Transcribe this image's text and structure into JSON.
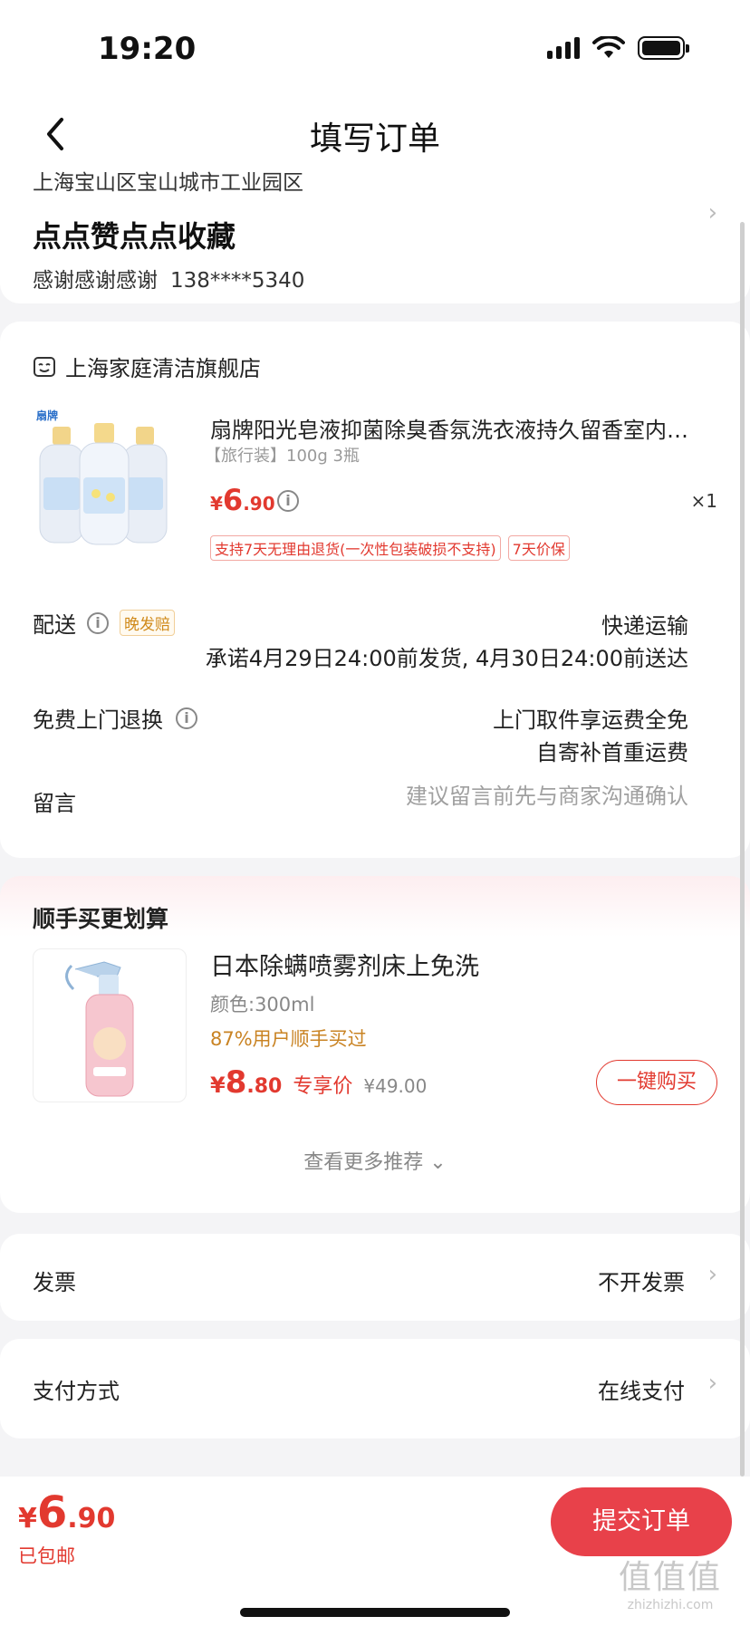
{
  "status": {
    "time": "19:20"
  },
  "nav": {
    "title": "填写订单"
  },
  "address": {
    "region": "上海宝山区宝山城市工业园区",
    "name": "点点赞点点收藏",
    "contact": "感谢感谢感谢",
    "phone": "138****5340"
  },
  "order": {
    "shop_name": "上海家庭清洁旗舰店",
    "product": {
      "brand_on_label": "扇牌",
      "title": "扇牌阳光皂液抑菌除臭香氛洗衣液持久留香室内…",
      "spec": "【旅行装】100g 3瓶",
      "price_currency": "¥",
      "price_int": "6",
      "price_dec": ".90",
      "quantity": "×1",
      "tags": [
        "支持7天无理由退货(一次性包装破损不支持)",
        "7天价保"
      ]
    },
    "shipping": {
      "label": "配送",
      "late_tag": "晚发赔",
      "method": "快递运输",
      "promise": "承诺4月29日24:00前发货, 4月30日24:00前送达"
    },
    "free_return": {
      "label": "免费上门退换",
      "line1": "上门取件享运费全免",
      "line2": "自寄补首重运费"
    },
    "message": {
      "label": "留言",
      "placeholder": "建议留言前先与商家沟通确认"
    }
  },
  "recommend": {
    "title": "顺手买更划算",
    "item": {
      "name": "日本除螨喷雾剂床上免洗",
      "spec": "颜色:300ml",
      "social_proof": "87%用户顺手买过",
      "price_currency": "¥",
      "price_int": "8",
      "price_dec": ".80",
      "price_label": "专享价",
      "original_price": "¥49.00",
      "buy_button": "一键购买"
    },
    "see_more": "查看更多推荐 ⌄"
  },
  "invoice": {
    "label": "发票",
    "value": "不开发票"
  },
  "payment": {
    "label": "支付方式",
    "value": "在线支付"
  },
  "footer": {
    "price_currency": "¥",
    "price_int": "6",
    "price_dec": ".90",
    "shipping_note": "已包邮",
    "submit_label": "提交订单"
  },
  "watermark": {
    "logo": "值值值",
    "url": "zhizhizhi.com"
  },
  "icons": {
    "back": "chevron-left-icon",
    "shop": "shop-face-icon",
    "info": "info-circle-icon",
    "chevron": "chevron-right-icon"
  },
  "colors": {
    "accent": "#e2392f",
    "submit": "#e8414a",
    "social": "#c98323"
  }
}
